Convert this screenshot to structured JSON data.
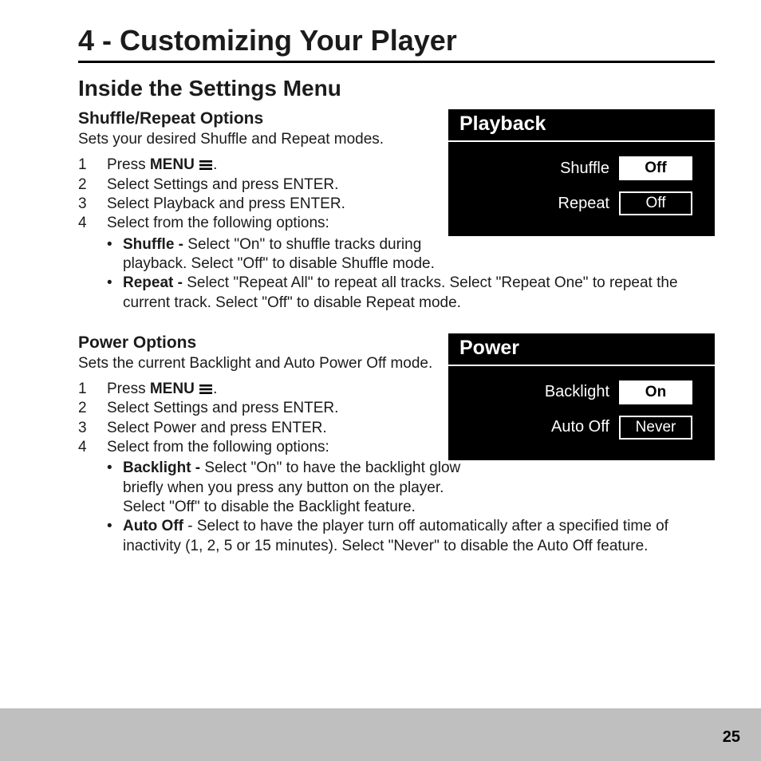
{
  "chapter_title": "4 - Customizing Your Player",
  "section_title": "Inside the Settings Menu",
  "page_number": "25",
  "shuffle": {
    "heading": "Shuffle/Repeat Options",
    "intro": "Sets your desired Shuffle and Repeat modes.",
    "step1_a": "Press ",
    "step1_b": "MENU",
    "step1_c": ".",
    "step2": "Select Settings and press ENTER.",
    "step3": "Select Playback and press ENTER.",
    "step4": "Select from the following options:",
    "b1_label": "Shuffle - ",
    "b1_text": "Select \"On\" to shuffle tracks during playback. Select \"Off\" to disable Shuffle mode.",
    "b2_label": "Repeat - ",
    "b2_text": "Select \"Repeat All\" to repeat all tracks. Select \"Repeat One\" to repeat the current track. Select \"Off\" to disable Repeat mode."
  },
  "power": {
    "heading": "Power Options",
    "intro": "Sets the current Backlight and Auto Power Off mode.",
    "step1_a": "Press ",
    "step1_b": "MENU",
    "step1_c": ".",
    "step2": "Select Settings and press ENTER.",
    "step3": "Select Power and press ENTER.",
    "step4": "Select from the following options:",
    "b1_label": "Backlight - ",
    "b1_text": "Select \"On\" to have the backlight glow briefly when you press any button on the player. Select \"Off\" to disable the Backlight feature.",
    "b2_label": "Auto Off",
    "b2_text": " - Select to have the player turn off automatically after a specified time of inactivity (1, 2, 5 or 15 minutes). Select \"Never\" to disable the Auto Off feature."
  },
  "panel_playback": {
    "title": "Playback",
    "row1_label": "Shuffle",
    "row1_value": "Off",
    "row2_label": "Repeat",
    "row2_value": "Off"
  },
  "panel_power": {
    "title": "Power",
    "row1_label": "Backlight",
    "row1_value": "On",
    "row2_label": "Auto Off",
    "row2_value": "Never"
  }
}
